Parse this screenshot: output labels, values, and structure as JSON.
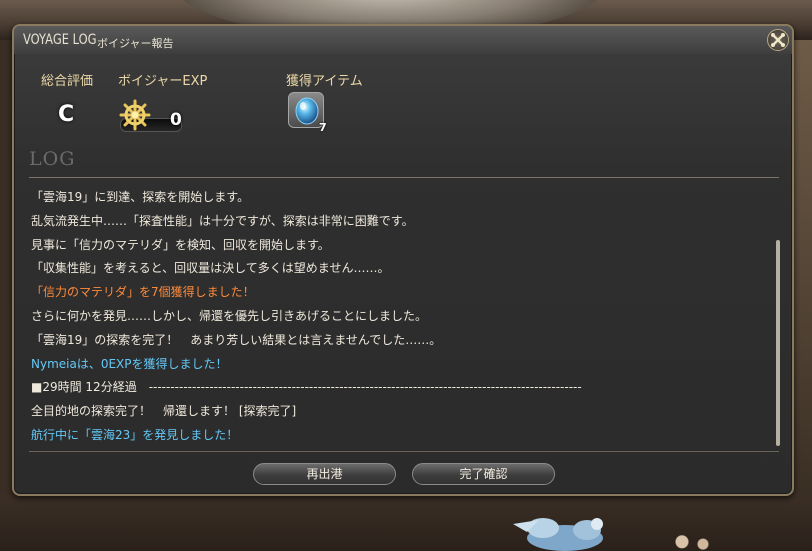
{
  "window": {
    "title_en": "VOYAGE LOG",
    "title_jp": "ボイジャー報告",
    "close_icon": "close-icon"
  },
  "summary": {
    "overall_label": "総合評価",
    "overall_grade": "C",
    "exp_label": "ボイジャーEXP",
    "exp_value": "0",
    "exp_icon": "ship-wheel-icon",
    "items_label": "獲得アイテム",
    "item_icon": "crystal-icon",
    "item_count": "7"
  },
  "log": {
    "heading": "LOG",
    "lines": [
      {
        "text": "「雲海19」に到達、探索を開始します。",
        "color": "white"
      },
      {
        "text": "乱気流発生中……「探査性能」は十分ですが、探索は非常に困難です。",
        "color": "white"
      },
      {
        "text": "見事に「信力のマテリダ」を検知、回収を開始します。",
        "color": "white"
      },
      {
        "text": "「収集性能」を考えると、回収量は決して多くは望めません……。",
        "color": "white"
      },
      {
        "text": "「信力のマテリダ」を7個獲得しました！",
        "color": "orange"
      },
      {
        "text": "さらに何かを発見……しかし、帰還を優先し引きあげることにしました。",
        "color": "white"
      },
      {
        "text": "「雲海19」の探索を完了！　あまり芳しい結果とは言えませんでした……。",
        "color": "white"
      },
      {
        "text": "Nymeiaは、0EXPを獲得しました！",
        "color": "cyan"
      },
      {
        "text": "■29時間 12分経過　----------------------------------------------------------------------------------------------------",
        "color": "white"
      },
      {
        "text": "全目的地の探索完了！　帰還します！ [探索完了]",
        "color": "white"
      },
      {
        "text": "航行中に「雲海23」を発見しました！",
        "color": "cyan"
      }
    ]
  },
  "buttons": {
    "redepart": "再出港",
    "complete": "完了確認"
  },
  "colors": {
    "orange_text": "#ff8a3a",
    "cyan_text": "#63c8f7",
    "label_gold": "#ecd9a8"
  }
}
